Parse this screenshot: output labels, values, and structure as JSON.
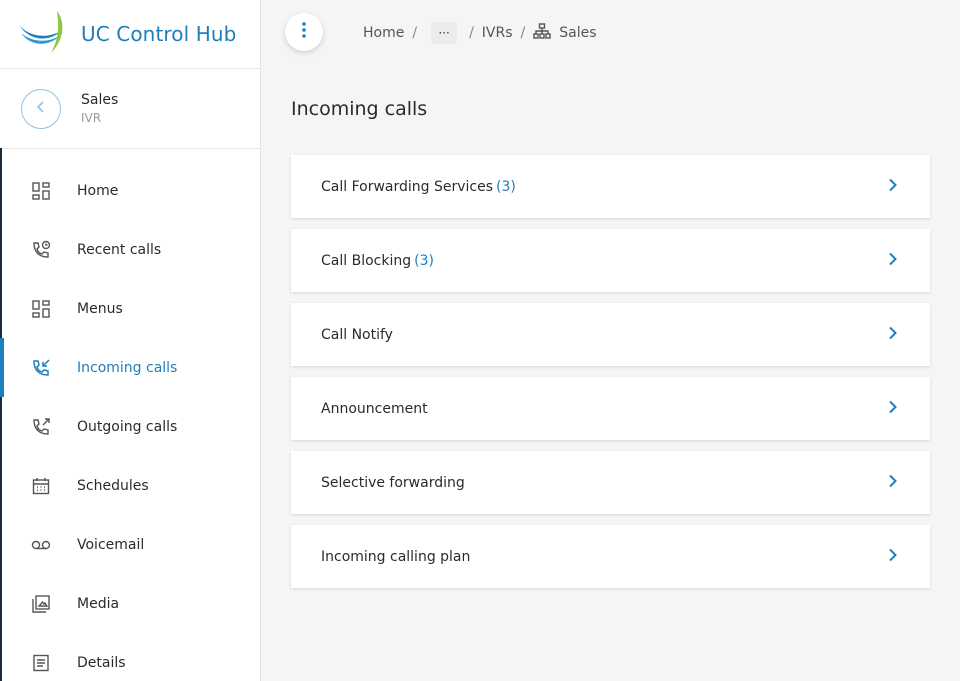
{
  "brand": {
    "title": "UC Control Hub"
  },
  "context": {
    "name": "Sales",
    "type": "IVR"
  },
  "sidebar": {
    "items": [
      {
        "label": "Home",
        "icon": "dashboard-icon",
        "active": false
      },
      {
        "label": "Recent calls",
        "icon": "phone-clock-icon",
        "active": false
      },
      {
        "label": "Menus",
        "icon": "dashboard-icon",
        "active": false
      },
      {
        "label": "Incoming calls",
        "icon": "phone-incoming-icon",
        "active": true
      },
      {
        "label": "Outgoing calls",
        "icon": "phone-outgoing-icon",
        "active": false
      },
      {
        "label": "Schedules",
        "icon": "calendar-icon",
        "active": false
      },
      {
        "label": "Voicemail",
        "icon": "voicemail-icon",
        "active": false
      },
      {
        "label": "Media",
        "icon": "media-library-icon",
        "active": false
      },
      {
        "label": "Details",
        "icon": "document-icon",
        "active": false
      }
    ]
  },
  "breadcrumb": {
    "home": "Home",
    "ellipsis": "···",
    "ivrs": "IVRs",
    "current": "Sales"
  },
  "main": {
    "title": "Incoming calls",
    "cards": [
      {
        "label": "Call Forwarding Services",
        "count": "(3)"
      },
      {
        "label": "Call Blocking",
        "count": "(3)"
      },
      {
        "label": "Call Notify",
        "count": ""
      },
      {
        "label": "Announcement",
        "count": ""
      },
      {
        "label": "Selective forwarding",
        "count": ""
      },
      {
        "label": "Incoming calling plan",
        "count": ""
      }
    ]
  },
  "colors": {
    "accent": "#1f7fbd",
    "logo_green": "#8dc63f",
    "text": "#2b2b2b"
  }
}
